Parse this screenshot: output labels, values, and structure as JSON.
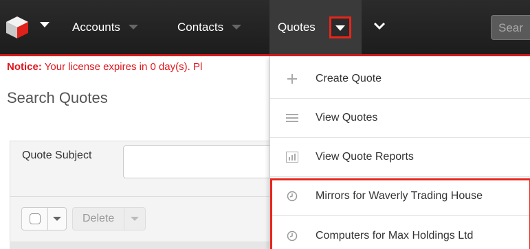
{
  "navbar": {
    "logo_icon": "sugar-cube-logo-icon",
    "tabs": [
      {
        "label": "Accounts"
      },
      {
        "label": "Contacts"
      },
      {
        "label": "Quotes"
      }
    ],
    "more_icon": "chevron-down-icon",
    "search_placeholder": "Sear",
    "accent_color": "#d51a1a"
  },
  "notice": {
    "label": "Notice:",
    "text": "Your license expires in 0 day(s). Pl"
  },
  "page": {
    "title": "Search Quotes"
  },
  "search_panel": {
    "field_label": "Quote Subject",
    "field_value": "",
    "delete_label": "Delete"
  },
  "quotes_menu": {
    "items": [
      {
        "label": "Create Quote",
        "icon": "plus-icon"
      },
      {
        "label": "View Quotes",
        "icon": "list-icon"
      },
      {
        "label": "View Quote Reports",
        "icon": "bar-chart-icon"
      },
      {
        "label": "Mirrors for Waverly Trading House",
        "icon": "clock-icon"
      },
      {
        "label": "Computers for Max Holdings Ltd",
        "icon": "clock-icon"
      }
    ]
  }
}
